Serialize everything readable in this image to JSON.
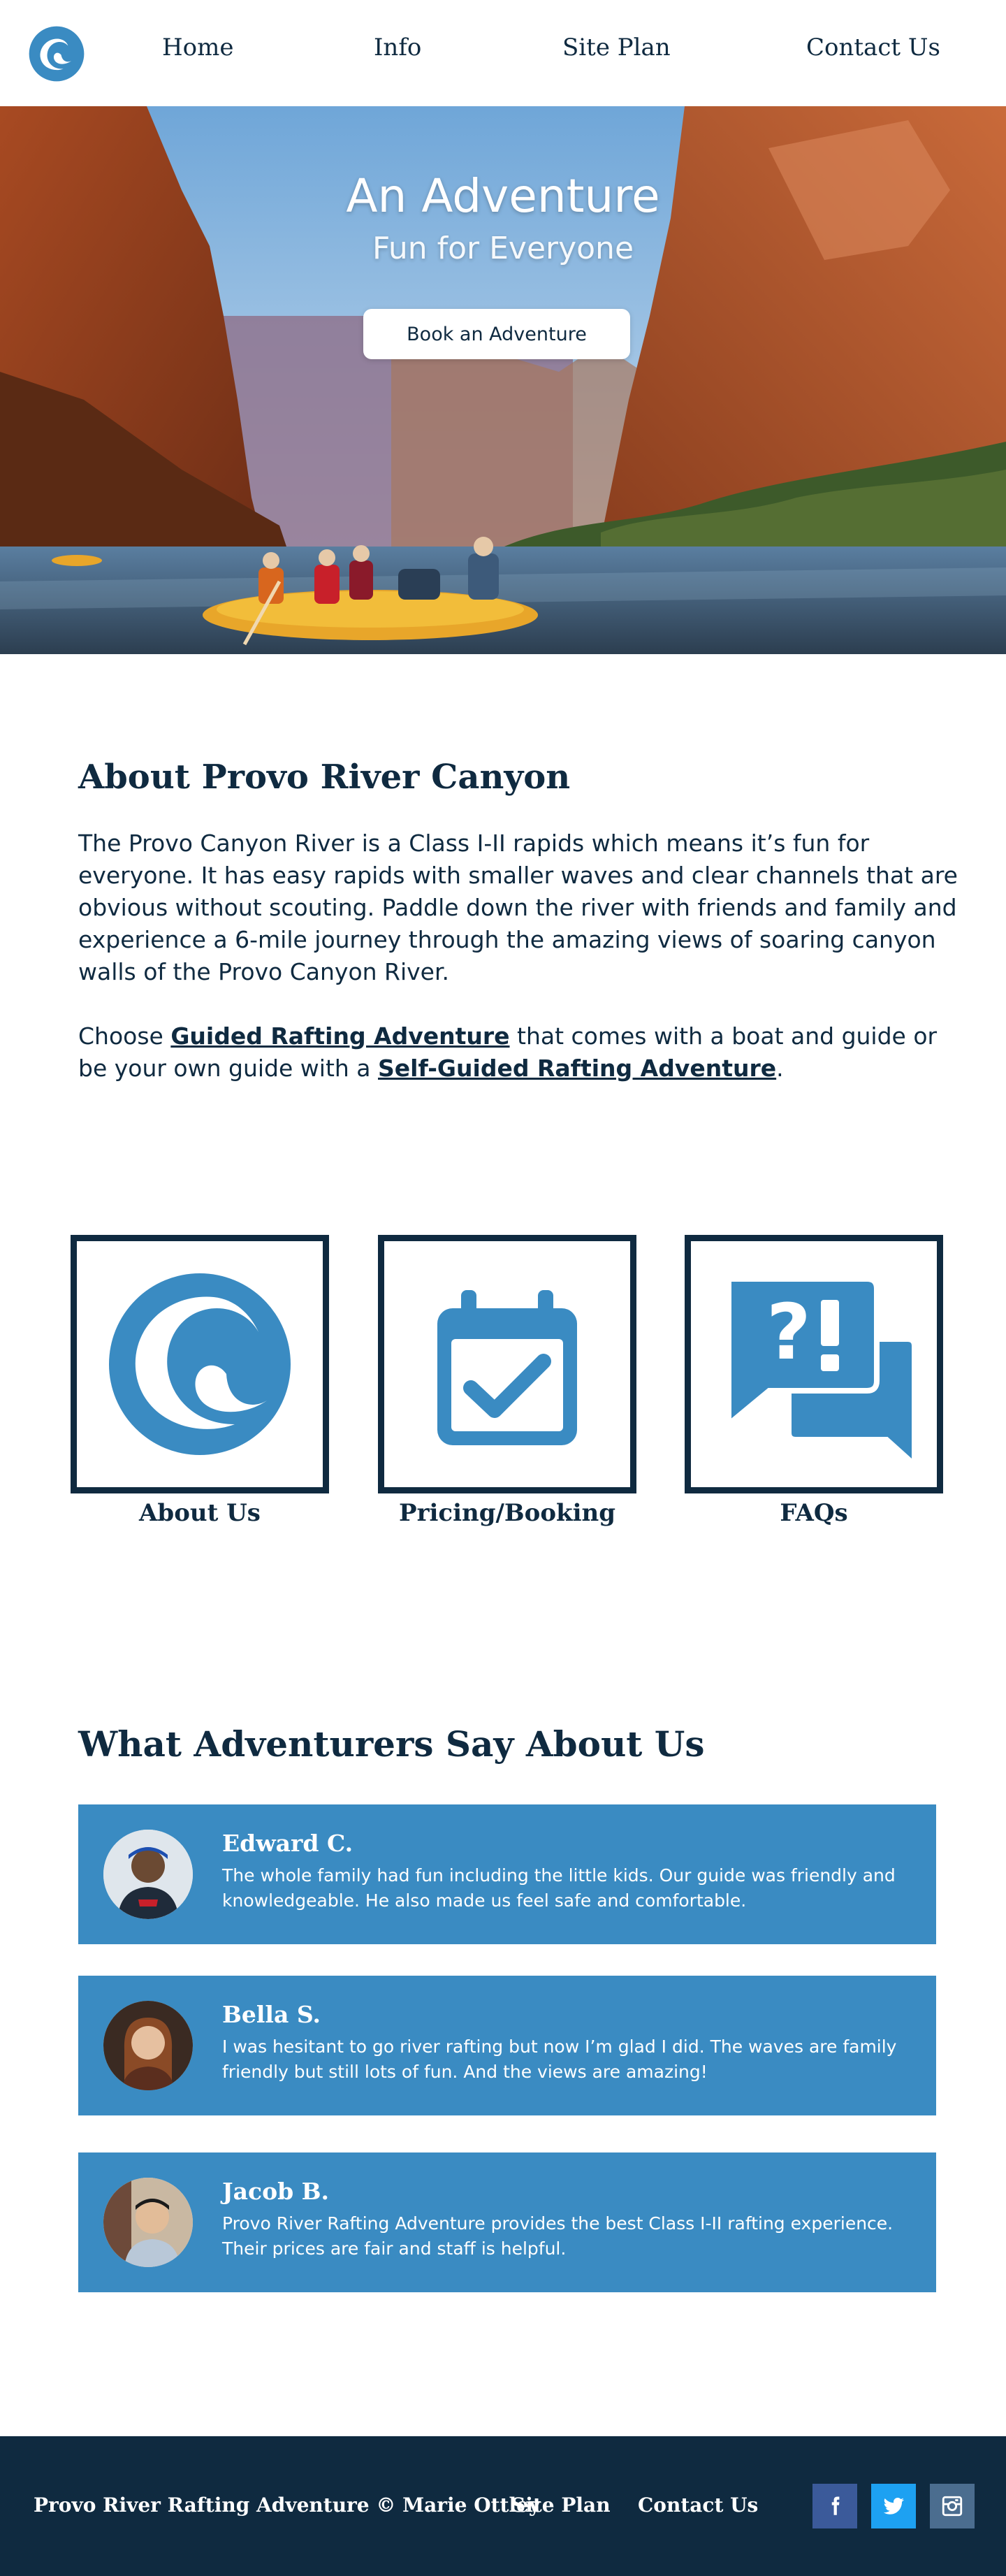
{
  "colors": {
    "navy": "#0f2a40",
    "accent_blue": "#3a8bc2",
    "white": "#ffffff",
    "facebook": "#3b5a9a",
    "twitter": "#1da1f2",
    "instagram": "#4b6d8f"
  },
  "header": {
    "logo_icon": "wave-logo-icon",
    "nav": [
      "Home",
      "Info",
      "Site Plan",
      "Contact Us"
    ]
  },
  "hero": {
    "title": "An Adventure",
    "subtitle": "Fun for Everyone",
    "button_label": "Book an Adventure"
  },
  "about": {
    "title": "About Provo River Canyon",
    "paragraph1": "The Provo Canyon River is a Class I-II rapids which means it’s fun for everyone. It has easy rapids with smaller waves and clear channels that are obvious without scouting. Paddle down the river with friends and family and experience a 6-mile journey through the amazing views of soaring canyon walls of the Provo Canyon River.",
    "p2_pre": "Choose ",
    "p2_link1": "Guided Rafting Adventure",
    "p2_mid": " that comes with a boat and guide or be your own guide with a ",
    "p2_link2": "Self-Guided Rafting Adventure",
    "p2_post": "."
  },
  "cards": [
    {
      "label": "About Us",
      "icon": "wave-icon"
    },
    {
      "label": "Pricing/Booking",
      "icon": "calendar-check-icon"
    },
    {
      "label": "FAQs",
      "icon": "question-exclamation-chat-icon"
    }
  ],
  "testimonials": {
    "title": "What Adventurers Say About Us",
    "items": [
      {
        "name": "Edward C.",
        "text": "The whole family had fun including the little kids. Our guide was friendly and knowledgeable. He also made us feel safe and comfortable."
      },
      {
        "name": "Bella S.",
        "text": "I was hesitant to go river rafting but now I’m glad I did. The waves are family friendly but still lots of fun. And the views are amazing!"
      },
      {
        "name": "Jacob B.",
        "text": "Provo River Rafting Adventure provides the best Class I-II rafting experience. Their prices are fair and staff is helpful."
      }
    ]
  },
  "footer": {
    "copyright": "Provo River Rafting Adventure © Marie Ottley",
    "links": [
      "Site Plan",
      "Contact Us"
    ],
    "social_icons": [
      "facebook-icon",
      "twitter-icon",
      "instagram-icon"
    ]
  }
}
